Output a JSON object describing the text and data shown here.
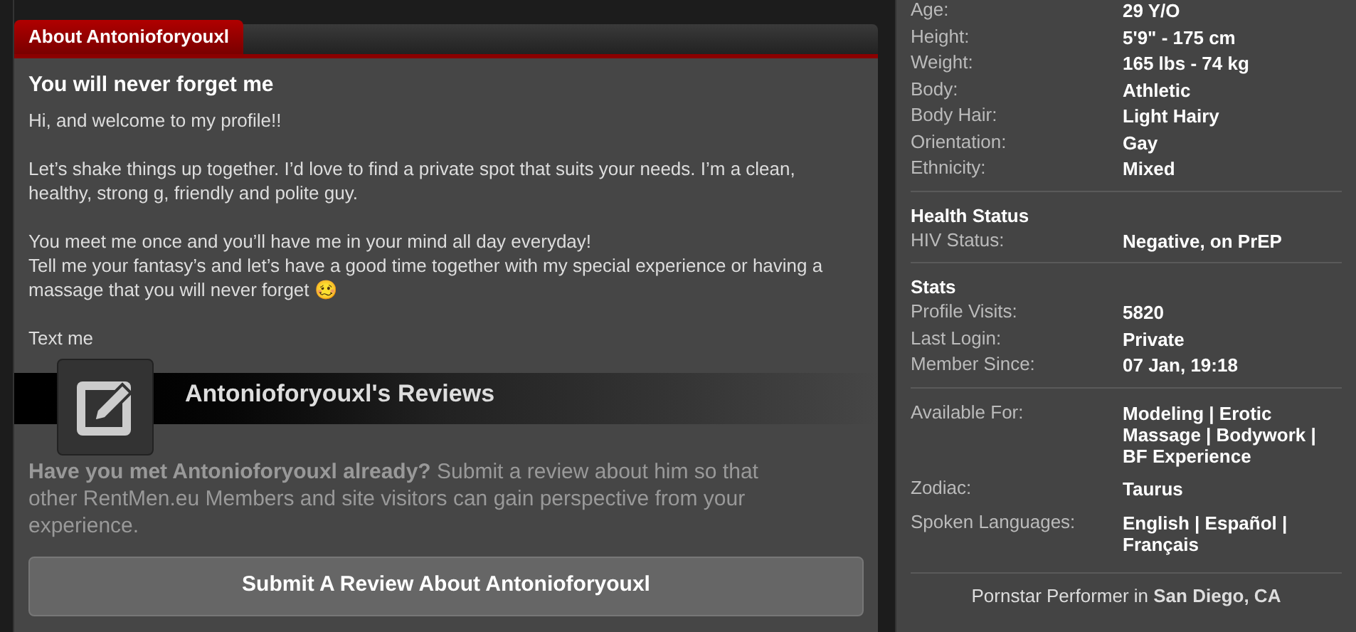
{
  "about_tab": {
    "label": "About Antonioforyouxl",
    "selected": true
  },
  "headline": "You will never forget me",
  "description": [
    [
      "Hi, and welcome to my profile!!"
    ],
    [
      "Let’s shake things up together. I’d love to find a private spot that suits your needs. I’m a clean, healthy, strong g, friendly and polite guy."
    ],
    [
      "You meet me once and you’ll have me in your mind all day everyday!",
      "Tell me your fantasy’s and let’s have a good time together with my special experience or having a massage that you will never forget 🥴"
    ],
    [
      "Text me"
    ]
  ],
  "reviews": {
    "title": "Antonioforyouxl's Reviews",
    "prompt": "**Have you met Antonioforyouxl already?** Submit a review about him so that other RentMen.eu Members and site visitors can gain perspective from your experience.",
    "button": "Submit A Review About Antonioforyouxl"
  },
  "details": [
    {
      "rows": [
        {
          "label": "Age:",
          "value": "29 Y/O"
        },
        {
          "label": "Height:",
          "value": "5'9\" - 175 cm"
        },
        {
          "label": "Weight:",
          "value": "165 lbs - 74 kg"
        },
        {
          "label": "Body:",
          "value": "Athletic"
        },
        {
          "label": "Body Hair:",
          "value": "Light Hairy"
        },
        {
          "label": "Orientation:",
          "value": "Gay"
        },
        {
          "label": "Ethnicity:",
          "value": "Mixed"
        }
      ]
    },
    {
      "heading": "Health Status",
      "rows": [
        {
          "label": "HIV Status:",
          "value": "Negative, on PrEP"
        }
      ]
    },
    {
      "heading": "Stats",
      "rows": [
        {
          "label": "Profile Visits:",
          "value": "5820"
        },
        {
          "label": "Last Login:",
          "value": "Private"
        },
        {
          "label": "Member Since:",
          "value": "07 Jan, 19:18"
        }
      ]
    },
    {
      "rows": [
        {
          "label": "Available For:",
          "value": "Modeling | Erotic Massage | Bodywork | BF Experience"
        },
        {
          "label": "Zodiac:",
          "value": "Taurus"
        },
        {
          "label": "Spoken Languages:",
          "value": "English | Español | Français"
        }
      ]
    }
  ],
  "footer": "Pornstar Performer in **San Diego, CA**"
}
